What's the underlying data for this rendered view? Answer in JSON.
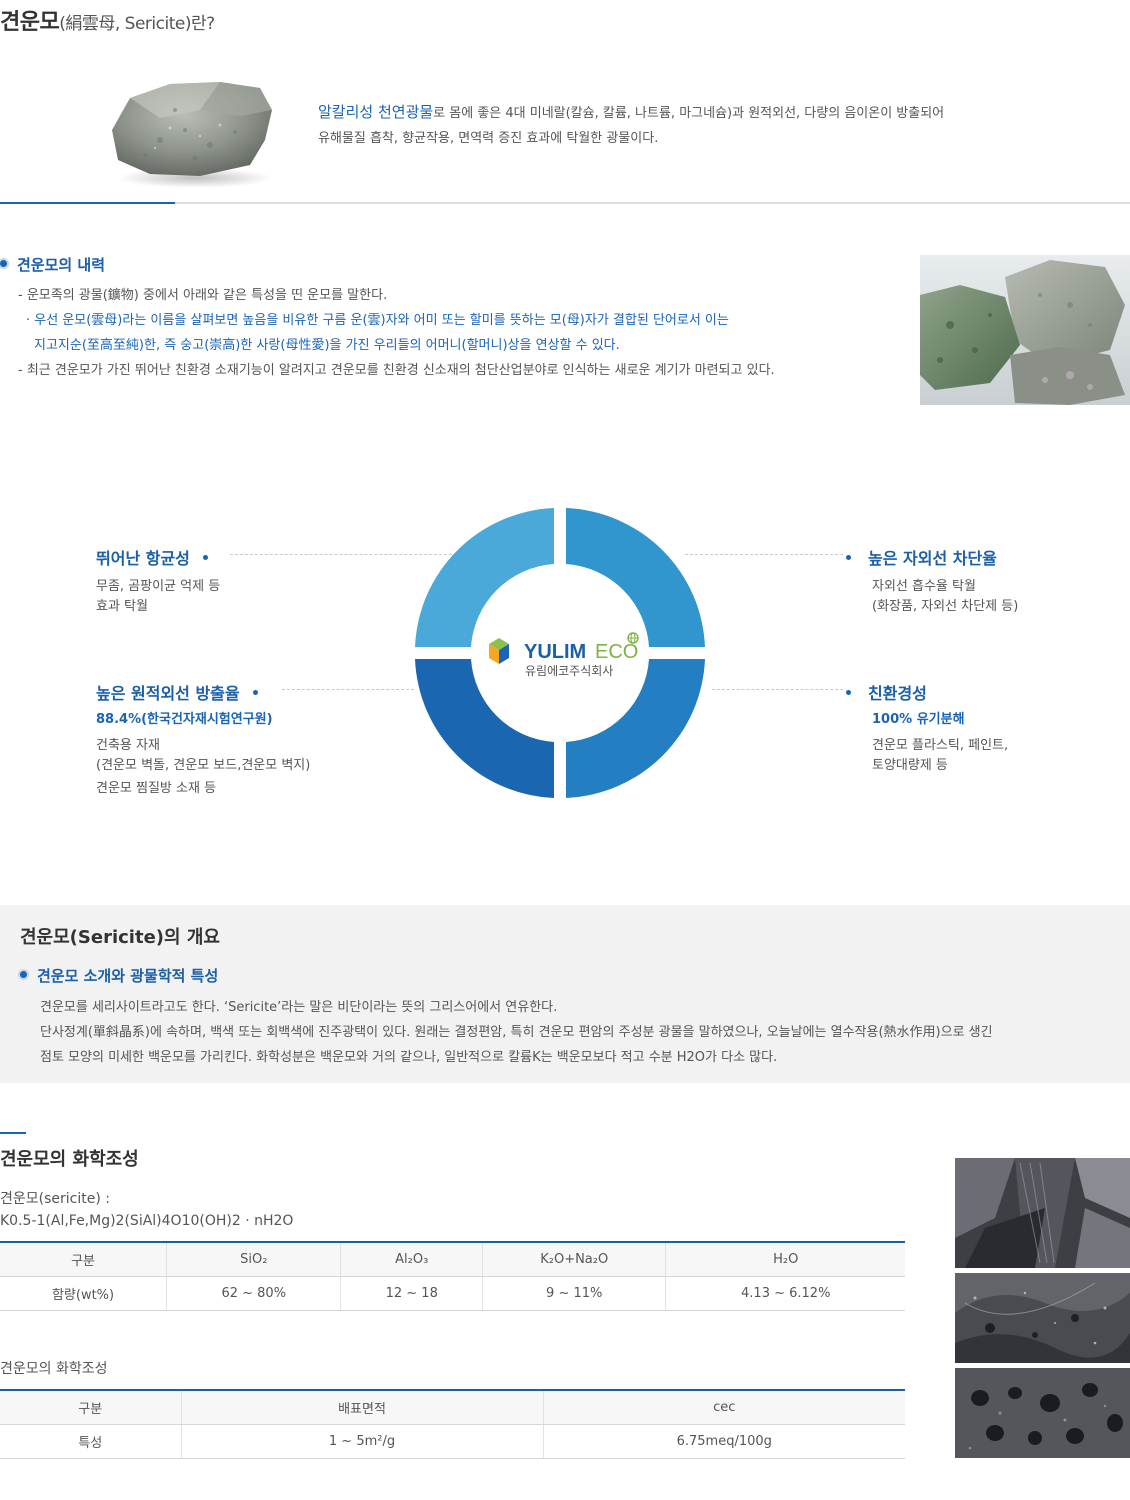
{
  "title": {
    "main": "견운모",
    "sub": "(絹雲母, Sericite)란?"
  },
  "intro": {
    "highlight": "알칼리성 천연광물",
    "line1_rest": "로 몸에 좋은 4대 미네랄(칼슘, 칼륨, 나트륨, 마그네슘)과 원적외선, 다량의 음이온이 방출되어",
    "line2": "유해물질 흡착, 향균작용, 면역력 증진 효과에 탁월한 광물이다."
  },
  "history": {
    "heading": "견운모의 내력",
    "lines": [
      "- 운모족의 광물(鑛物) 중에서 아래와 같은 특성을 띤 운모를 말한다.",
      "· 우선 운모(雲母)라는 이름을 살펴보면 높음을 비유한 구름 운(雲)자와 어미 또는 할미를 뜻하는 모(母)자가 결합된 단어로서 이는",
      "지고지순(至高至純)한, 즉 숭고(崇高)한 사랑(母性愛)을 가진 우리들의 어머니(할머니)상을 연상할 수 있다.",
      "- 최근 견운모가 가진 뛰어난 친환경 소재기능이 알려지고 견운모를 친환경 신소재의 첨단산업분야로 인식하는 새로운 계기가 마련되고 있다."
    ]
  },
  "logo": {
    "brand_a": "YULIM",
    "brand_b": "ECO",
    "company": "유림에코주식회사"
  },
  "features": {
    "antibacterial": {
      "title": "뛰어난 항균성",
      "desc": [
        "무좀, 곰팡이균 억제 등",
        "효과 탁월"
      ]
    },
    "uv": {
      "title": "높은 자외선 차단율",
      "desc": [
        "자외선 흡수율 탁월",
        "(화장품, 자외선 차단제 등)"
      ]
    },
    "infrared": {
      "title": "높은 원적외선 방출율",
      "sub": "88.4%(한국건자재시험연구원)",
      "desc": [
        "건축용 자재",
        "(견운모 벽돌, 견운모 보드,견운모 벽지)",
        "견운모 찜질방 소재 등"
      ]
    },
    "eco": {
      "title": "친환경성",
      "sub": "100% 유기분해",
      "desc": [
        "견운모 플라스틱, 페인트,",
        "토양대량제 등"
      ]
    }
  },
  "overview": {
    "title": "견운모(Sericite)의 개요",
    "heading": "견운모 소개와 광물학적 특성",
    "lines": [
      "견운모를 세리사이트라고도 한다. ‘Sericite’라는 말은 비단이라는 뜻의 그리스어에서 연유한다.",
      "단사정계(單斜晶系)에 속하며, 백색 또는 회백색에 진주광택이 있다. 원래는 결정편암, 특히 견운모 편암의 주성분 광물을 말하였으나, 오늘날에는 열수작용(熱水作用)으로 생긴",
      "점토 모양의 미세한 백운모를 가리킨다. 화학성분은 백운모와 거의 같으나, 일반적으로 칼륨K는 백운모보다 적고 수분 H2O가 다소 많다."
    ]
  },
  "chem": {
    "title": "견운모의 화학조성",
    "formula_label": "견운모(sericite) :",
    "formula": "K0.5-1(Al,Fe,Mg)2(SiAl)4O10(OH)2 · nH2O",
    "table1": {
      "headers": [
        "구분",
        "SiO₂",
        "Al₂O₃",
        "K₂O+Na₂O",
        "H₂O"
      ],
      "row": [
        "함량(wt%)",
        "62 ~ 80%",
        "12 ~ 18",
        "9 ~ 11%",
        "4.13 ~ 6.12%"
      ]
    },
    "table2_caption": "견운모의 화학조성",
    "table2": {
      "headers": [
        "구분",
        "배표면적",
        "cec"
      ],
      "row": [
        "특성",
        "1 ~ 5m²/g",
        "6.75meq/100g"
      ]
    }
  },
  "colors": {
    "accent": "#1a64b8",
    "ring_top_left": "#4aa9d8",
    "ring_top_right": "#3296ce",
    "ring_bottom_right": "#237fc1",
    "ring_bottom_left": "#1b66b0"
  }
}
